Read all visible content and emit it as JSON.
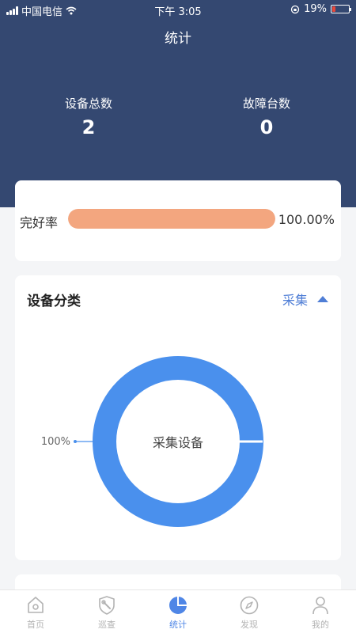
{
  "status_bar": {
    "carrier": "中国电信",
    "time": "下午 3:05",
    "battery": "19%",
    "battery_level": 0.19
  },
  "header": {
    "title": "统计",
    "stats": [
      {
        "label": "设备总数",
        "value": "2"
      },
      {
        "label": "故障台数",
        "value": "0"
      }
    ]
  },
  "rate_card": {
    "label": "完好率",
    "value": "100.00%",
    "fraction": 1.0,
    "bar_color": "#f3a67f"
  },
  "category_card": {
    "title": "设备分类",
    "selected": "采集"
  },
  "chart_data": {
    "type": "pie",
    "donut": true,
    "center_label": "采集设备",
    "slices": [
      {
        "name": "采集设备",
        "percent": 100,
        "label": "100%",
        "color": "#4a90ed"
      }
    ]
  },
  "tabbar": {
    "tabs": [
      {
        "label": "首页",
        "icon": "home-icon",
        "active": false
      },
      {
        "label": "巡查",
        "icon": "shield-wrench-icon",
        "active": false
      },
      {
        "label": "统计",
        "icon": "pie-chart-icon",
        "active": true
      },
      {
        "label": "发现",
        "icon": "compass-icon",
        "active": false
      },
      {
        "label": "我的",
        "icon": "user-icon",
        "active": false
      }
    ],
    "active_color": "#4f86e6"
  }
}
